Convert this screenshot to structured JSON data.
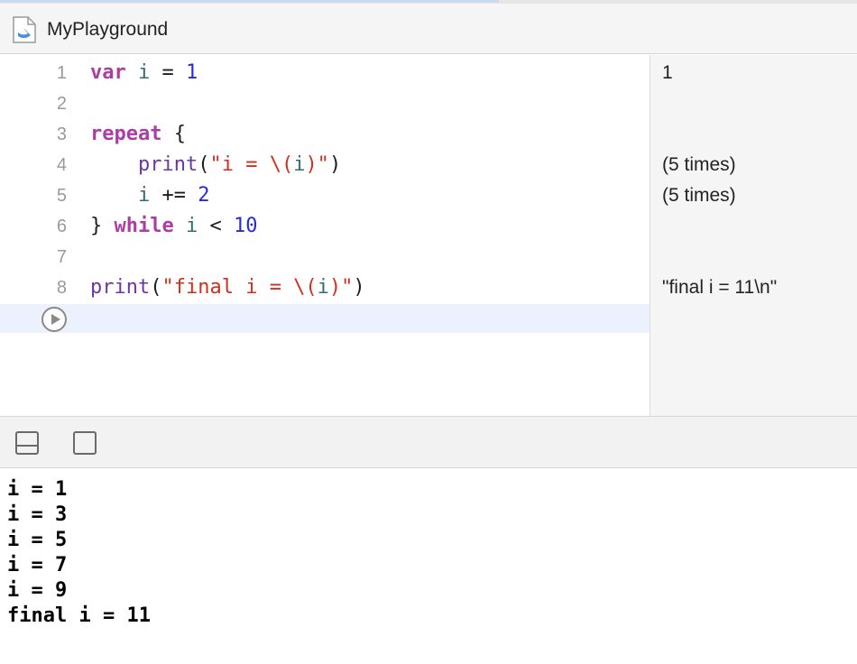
{
  "window": {
    "title": "MyPlayground",
    "file_icon": "swift-file-icon"
  },
  "editor": {
    "lines": [
      {
        "number": "1",
        "tokens": {
          "t1": "var",
          "t2": "i",
          "t3": "=",
          "t4": "1"
        }
      },
      {
        "number": "2"
      },
      {
        "number": "3",
        "tokens": {
          "t1": "repeat",
          "t2": "{"
        }
      },
      {
        "number": "4",
        "tokens": {
          "t1": "print",
          "t2": "(",
          "t3": "\"i = \\(",
          "t4": "i",
          "t5": ")\"",
          "t6": ")"
        }
      },
      {
        "number": "5",
        "tokens": {
          "t1": "i",
          "t2": "+=",
          "t3": "2"
        }
      },
      {
        "number": "6",
        "tokens": {
          "t1": "}",
          "t2": "while",
          "t3": "i",
          "t4": "<",
          "t5": "10"
        }
      },
      {
        "number": "7"
      },
      {
        "number": "8",
        "tokens": {
          "t1": "print",
          "t2": "(",
          "t3": "\"final i = \\(",
          "t4": "i",
          "t5": ")\"",
          "t6": ")"
        }
      }
    ],
    "run_button_icon": "play-icon"
  },
  "results": {
    "line1": "1",
    "line4": "(5 times)",
    "line5": "(5 times)",
    "line8": "\"final i = 11\\n\""
  },
  "console_toolbar": {
    "hide_debug_icon": "split-panel-icon",
    "clear_icon": "square-icon"
  },
  "console": {
    "output": [
      "i = 1",
      "i = 3",
      "i = 5",
      "i = 7",
      "i = 9",
      "final i = 11"
    ]
  },
  "colors": {
    "keyword": "#ad3da4",
    "variable": "#326d74",
    "number": "#272ad8",
    "string": "#d12f1b",
    "function": "#6c36a9",
    "current_line": "#ecf2fd"
  }
}
